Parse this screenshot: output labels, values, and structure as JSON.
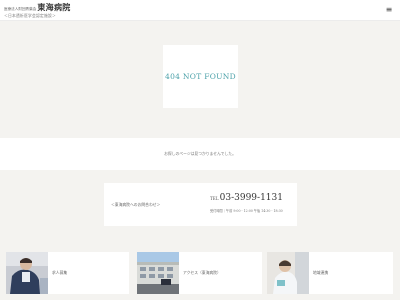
{
  "header": {
    "logo_corp": "医療法人財団青葉会",
    "logo_name": "東海病院",
    "logo_sub": "＜日本透析医学会認定施設＞",
    "menu_glyph": "≡"
  },
  "not_found": {
    "title": "404 NOT FOUND",
    "message": "お探しのページは見つかりませんでした。"
  },
  "contact": {
    "label": "＜東海病院へのお問合わせ＞",
    "tel_prefix": "TEL",
    "tel_number": "03-3999-1131",
    "hours": "受付時間｜午前 9:00 - 12:00 午後 14:30 - 18:30"
  },
  "cards": [
    {
      "label": "求人募集",
      "icon": "staff-photo"
    },
    {
      "label": "アクセス（東海病院）",
      "icon": "building-photo"
    },
    {
      "label": "地域連携",
      "icon": "nurse-photo"
    }
  ],
  "colors": {
    "accent": "#4aa0a8",
    "background": "#f4f3f0"
  }
}
